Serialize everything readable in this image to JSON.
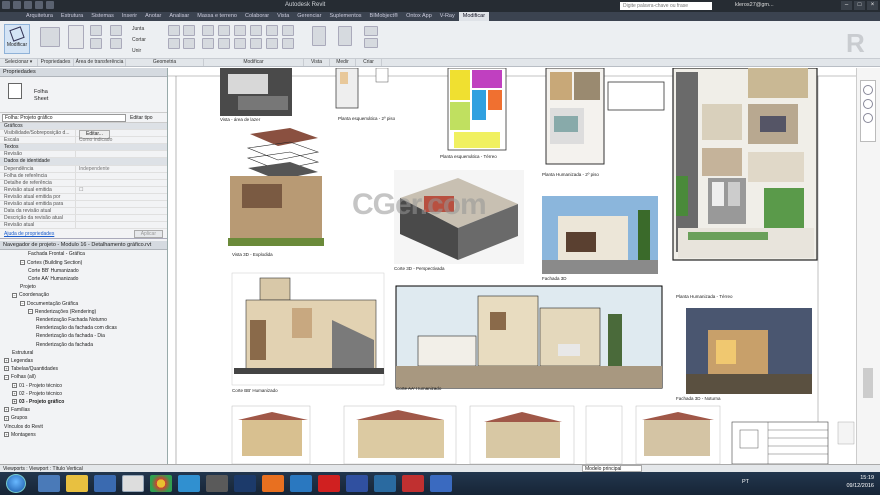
{
  "titlebar": {
    "title": "Autodesk Revit",
    "search_placeholder": "Digite palavra-chave ou frase",
    "user": "kleros27@gm..."
  },
  "ribbon_tabs": [
    "Arquitetura",
    "Estrutura",
    "Sistemas",
    "Inserir",
    "Anotar",
    "Analisar",
    "Massa e terreno",
    "Colaborar",
    "Vista",
    "Gerenciar",
    "Suplementos",
    "BIMobject®",
    "Ontox App",
    "V-Ray",
    "Modificar"
  ],
  "ribbon": {
    "modify_label": "Modificar",
    "commands": [
      "Junta",
      "Cortar",
      "Unir"
    ],
    "groups": [
      "Selecionar ▾",
      "Propriedades",
      "Área de transferência",
      "Geometria",
      "Modificar",
      "Vista",
      "Medir",
      "Criar"
    ]
  },
  "properties": {
    "header": "Propriedades",
    "type_name": "Folha",
    "type_sub": "Sheet",
    "selector": "Folha: Projeto gráfico",
    "edit_type": "Editar tipo",
    "rows": [
      {
        "k": "Gráficos",
        "v": "",
        "hdr": true
      },
      {
        "k": "Visibilidade/Sobreposição d...",
        "v": "Editar...",
        "btn": true
      },
      {
        "k": "Escala",
        "v": "Como indicado"
      },
      {
        "k": "Textos",
        "v": "",
        "hdr": true
      },
      {
        "k": "Revisão",
        "v": ""
      },
      {
        "k": "Dados de identidade",
        "v": "",
        "hdr": true
      },
      {
        "k": "Dependência",
        "v": "Independente"
      },
      {
        "k": "Folha de referência",
        "v": ""
      },
      {
        "k": "Detalhe de referência",
        "v": ""
      },
      {
        "k": "Revisão atual emitida",
        "v": "☐"
      },
      {
        "k": "Revisão atual emitida por",
        "v": ""
      },
      {
        "k": "Revisão atual emitida para",
        "v": ""
      },
      {
        "k": "Data da revisão atual",
        "v": ""
      },
      {
        "k": "Descrição da revisão atual",
        "v": ""
      },
      {
        "k": "Revisão atual",
        "v": ""
      }
    ],
    "help": "Ajuda de propriedades",
    "apply": "Aplicar"
  },
  "project_browser": {
    "header": "Navegador de projeto - Modulo 16 - Detalhamento gráfico.rvt",
    "items": [
      {
        "t": "Fachada Frontal - Gráfica",
        "i": 28
      },
      {
        "t": "Cortes (Building Section)",
        "i": 20,
        "e": "−"
      },
      {
        "t": "Corte BB' Humanizado",
        "i": 28
      },
      {
        "t": "Corte AA' Humanizado",
        "i": 28
      },
      {
        "t": "Projeto",
        "i": 20
      },
      {
        "t": "Coordenação",
        "i": 12,
        "e": "−"
      },
      {
        "t": "Documentação Gráfica",
        "i": 20,
        "e": "−"
      },
      {
        "t": "Renderizações (Rendering)",
        "i": 28,
        "e": "−"
      },
      {
        "t": "Renderização Fachada Noturno",
        "i": 36
      },
      {
        "t": "Renderização da fachada com dicas",
        "i": 36
      },
      {
        "t": "Renderização da fachada - Dia",
        "i": 36
      },
      {
        "t": "Renderização da fachada",
        "i": 36
      },
      {
        "t": "Estrutural",
        "i": 12
      },
      {
        "t": "Legendas",
        "i": 4,
        "e": "+"
      },
      {
        "t": "Tabelas/Quantidades",
        "i": 4,
        "e": "+"
      },
      {
        "t": "Folhas (all)",
        "i": 4,
        "e": "−"
      },
      {
        "t": "01 - Projeto técnico",
        "i": 12,
        "e": "+"
      },
      {
        "t": "02 - Projeto técnico",
        "i": 12,
        "e": "+"
      },
      {
        "t": "03 - Projeto gráfico",
        "i": 12,
        "e": "+",
        "b": true
      },
      {
        "t": "Famílias",
        "i": 4,
        "e": "+"
      },
      {
        "t": "Grupos",
        "i": 4,
        "e": "+"
      },
      {
        "t": "Vínculos do Revit",
        "i": 4
      },
      {
        "t": "Montagens",
        "i": 4,
        "e": "+"
      }
    ]
  },
  "captions": {
    "vista": "Vista - área de lazer",
    "planta_sup": "Planta esquemática - 2º piso",
    "planta_hum": "Planta esquemática - Térreo",
    "planta_2p": "Planta Humanizada - 2º piso",
    "vista3d": "Vista 3D - Explodida",
    "corte3d": "Corte 3D - Perspectivada",
    "fachada3d": "Fachada 3D",
    "planta_terreo": "Planta Humanizada - Térreo",
    "corte_bb": "Corte BB' Humanizado",
    "corte_aa": "Corte AA' Humanizado",
    "fachada_noite": "Fachada 3D - Noturna"
  },
  "watermark": "CGer.com",
  "statusbar": {
    "text": "Viewports : Viewport : Título Vertical",
    "model": "Modelo principal"
  },
  "tray": {
    "lang": "PT",
    "time": "15:19",
    "date": "09/12/2016"
  }
}
